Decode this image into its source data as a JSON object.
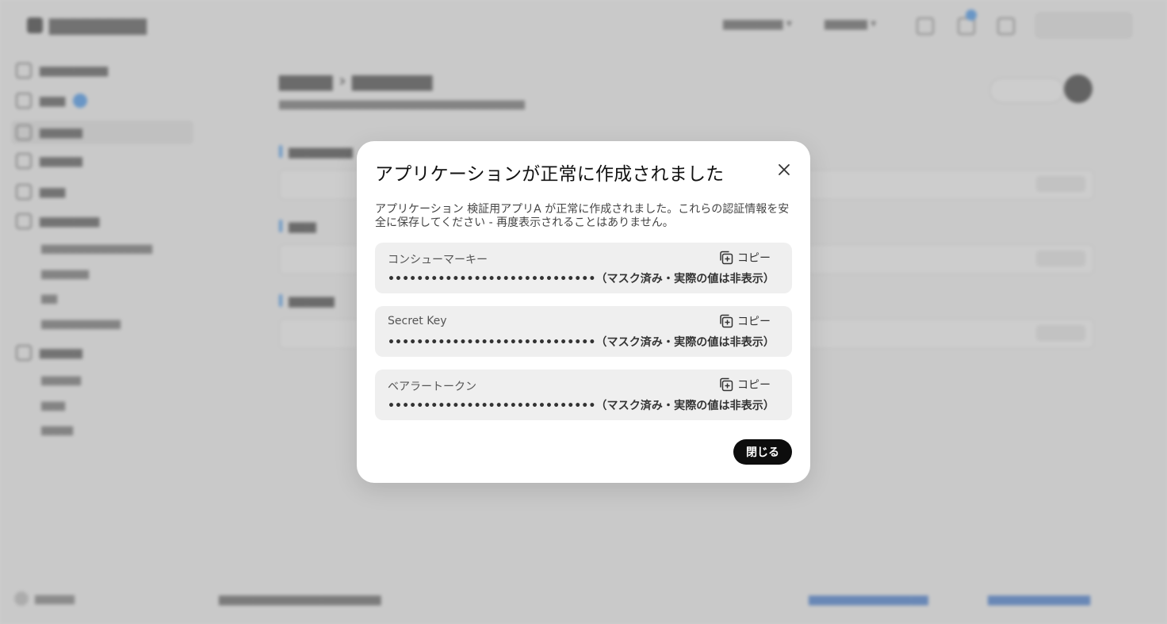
{
  "modal": {
    "title": "アプリケーションが正常に作成されました",
    "description": "アプリケーション 検証用アプリA が正常に作成されました。これらの認証情報を安全に保存してください - 再度表示されることはありません。",
    "copy_label": "コピー",
    "credentials": [
      {
        "label": "コンシューマーキー",
        "value": "•••••••••••••••••••••••••••••（マスク済み・実際の値は非表示）"
      },
      {
        "label": "Secret Key",
        "value": "•••••••••••••••••••••••••••••（マスク済み・実際の値は非表示）"
      },
      {
        "label": "ベアラートークン",
        "value": "•••••••••••••••••••••••••••••（マスク済み・実際の値は非表示）"
      }
    ],
    "close_button": "閉じる"
  },
  "colors": {
    "overlay": "#a0a0a0",
    "modal_bg": "#ffffff",
    "field_bg": "#efefef",
    "primary_button": "#0d0d0d"
  },
  "icons": {
    "close": "close-icon",
    "copy": "copy-icon"
  }
}
